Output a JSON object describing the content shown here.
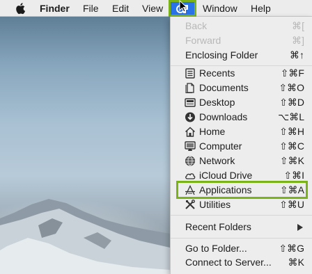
{
  "menubar": {
    "app_name": "Finder",
    "items": [
      "File",
      "Edit",
      "View",
      "Window",
      "Help"
    ],
    "active_menu_icon": "go-menu-icon"
  },
  "go_menu": {
    "navigation": [
      {
        "label": "Back",
        "shortcut": "⌘[",
        "enabled": false
      },
      {
        "label": "Forward",
        "shortcut": "⌘]",
        "enabled": false
      },
      {
        "label": "Enclosing Folder",
        "shortcut": "⌘↑",
        "enabled": true
      }
    ],
    "locations": [
      {
        "label": "Recents",
        "shortcut": "⇧⌘F",
        "icon": "recents-icon"
      },
      {
        "label": "Documents",
        "shortcut": "⇧⌘O",
        "icon": "documents-icon"
      },
      {
        "label": "Desktop",
        "shortcut": "⇧⌘D",
        "icon": "desktop-icon"
      },
      {
        "label": "Downloads",
        "shortcut": "⌥⌘L",
        "icon": "downloads-icon"
      },
      {
        "label": "Home",
        "shortcut": "⇧⌘H",
        "icon": "home-icon"
      },
      {
        "label": "Computer",
        "shortcut": "⇧⌘C",
        "icon": "computer-icon"
      },
      {
        "label": "Network",
        "shortcut": "⇧⌘K",
        "icon": "network-icon"
      },
      {
        "label": "iCloud Drive",
        "shortcut": "⇧⌘I",
        "icon": "icloud-icon"
      },
      {
        "label": "Applications",
        "shortcut": "⇧⌘A",
        "icon": "applications-icon",
        "highlighted": true
      },
      {
        "label": "Utilities",
        "shortcut": "⇧⌘U",
        "icon": "utilities-icon"
      }
    ],
    "recent_folders": {
      "label": "Recent Folders"
    },
    "server": [
      {
        "label": "Go to Folder...",
        "shortcut": "⇧⌘G"
      },
      {
        "label": "Connect to Server...",
        "shortcut": "⌘K"
      }
    ]
  },
  "colors": {
    "menu_highlight": "#2a73e6",
    "annotation_outline": "#7ab317",
    "menu_bg": "#ededed",
    "disabled_text": "#b8b8b8"
  }
}
